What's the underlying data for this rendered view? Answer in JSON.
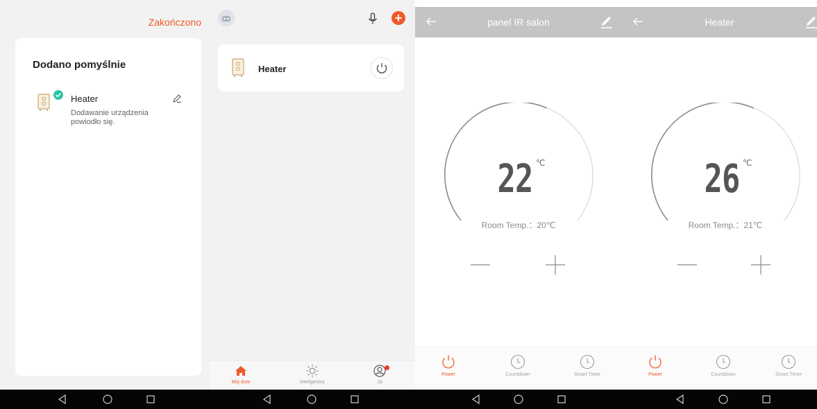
{
  "colors": {
    "accent": "#ef5a28",
    "check": "#2ec4a6",
    "header": "#c4c4c4"
  },
  "panel1": {
    "done_label": "Zakończono",
    "title": "Dodano pomyślnie",
    "device_name": "Heater",
    "device_status": "Dodawanie urządzenia powiodło się.",
    "icons": [
      "heater-icon",
      "check-icon",
      "pencil-icon"
    ]
  },
  "panel2": {
    "device_name": "Heater",
    "tabs": [
      {
        "label": "Mój dom",
        "icon": "home-icon",
        "active": true
      },
      {
        "label": "Inteligentny",
        "icon": "sun-icon",
        "active": false
      },
      {
        "label": "Ja",
        "icon": "profile-icon",
        "active": false
      }
    ]
  },
  "panel3": {
    "title": "panel IR salon",
    "temperature": "22",
    "unit": "℃",
    "room_temp": "Room Temp.：20℃",
    "controls": [
      {
        "label": "Power",
        "icon": "power-icon",
        "active": true
      },
      {
        "label": "Countdown",
        "icon": "clock-icon",
        "active": false
      },
      {
        "label": "Smart Timer",
        "icon": "clock-icon",
        "active": false
      }
    ]
  },
  "panel4": {
    "title": "Heater",
    "temperature": "26",
    "unit": "℃",
    "room_temp": "Room Temp.：21℃",
    "controls": [
      {
        "label": "Power",
        "icon": "power-icon",
        "active": true
      },
      {
        "label": "Countdown",
        "icon": "clock-icon",
        "active": false
      },
      {
        "label": "Smart Timer",
        "icon": "clock-icon",
        "active": false
      }
    ]
  }
}
